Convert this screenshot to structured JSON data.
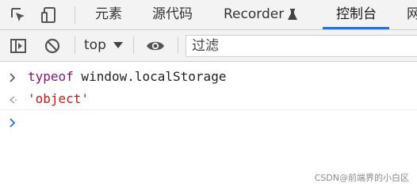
{
  "tabbar": {
    "tabs": [
      {
        "label": "元素"
      },
      {
        "label": "源代码"
      },
      {
        "label": "Recorder"
      },
      {
        "label": "控制台"
      },
      {
        "label": "网"
      }
    ],
    "active_tab": "控制台"
  },
  "toolbar": {
    "context": "top",
    "filter_placeholder": "过滤"
  },
  "console": {
    "input_keyword": "typeof",
    "input_rest": " window.localStorage",
    "result": "'object'"
  },
  "watermark": "CSDN@前端界的小白区",
  "colors": {
    "accent": "#1a73e8",
    "keyword": "#881280",
    "string": "#c41a16",
    "prompt": "#1a73e8"
  }
}
